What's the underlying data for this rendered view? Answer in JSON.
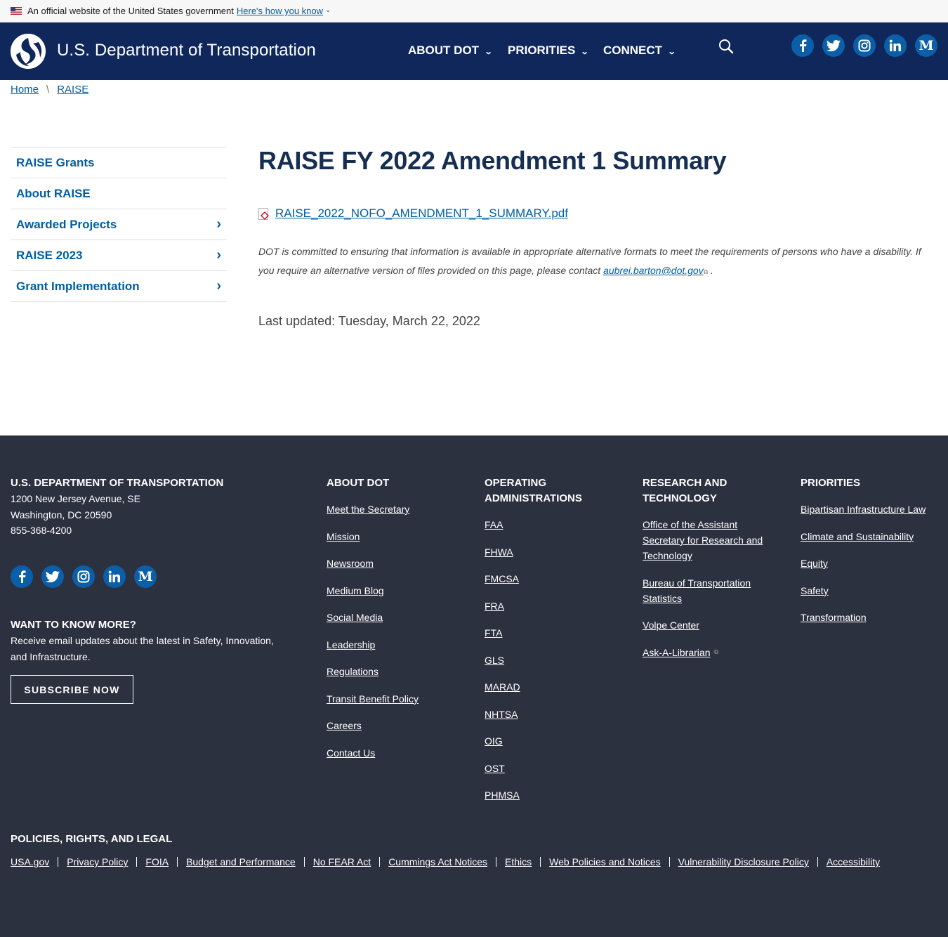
{
  "banner": {
    "text": "An official website of the United States government",
    "link": "Here's how you know"
  },
  "header": {
    "site_name": "U.S. Department of Transportation",
    "nav": [
      {
        "label": "ABOUT DOT"
      },
      {
        "label": "PRIORITIES"
      },
      {
        "label": "CONNECT"
      }
    ],
    "social": [
      {
        "icon": "facebook-icon",
        "glyph": "f"
      },
      {
        "icon": "twitter-icon",
        "glyph": "t"
      },
      {
        "icon": "instagram-icon",
        "glyph": "ig"
      },
      {
        "icon": "linkedin-icon",
        "glyph": "in"
      },
      {
        "icon": "medium-icon",
        "glyph": "M"
      }
    ]
  },
  "breadcrumb": {
    "items": [
      "Home",
      "RAISE"
    ],
    "separator": "\\"
  },
  "sidebar": {
    "items": [
      {
        "label": "RAISE Grants",
        "has_children": false
      },
      {
        "label": "About RAISE",
        "has_children": false
      },
      {
        "label": "Awarded Projects",
        "has_children": true
      },
      {
        "label": "RAISE 2023",
        "has_children": true
      },
      {
        "label": "Grant Implementation",
        "has_children": true
      }
    ]
  },
  "main": {
    "title": "RAISE FY 2022 Amendment 1 Summary",
    "file_name": "RAISE_2022_NOFO_AMENDMENT_1_SUMMARY.pdf",
    "notice_text": "DOT is committed to ensuring that information is available in appropriate alternative formats to meet the requirements of persons who have a disability. If you require an alternative version of files provided on this page, please contact",
    "notice_email": "aubrei.barton@dot.gov",
    "notice_end": ".",
    "last_updated": "Last updated: Tuesday, March 22, 2022"
  },
  "footer": {
    "org_head": "U.S. DEPARTMENT OF TRANSPORTATION",
    "address_line1": "1200 New Jersey Avenue, SE",
    "address_line2": "Washington, DC 20590",
    "phone": "855-368-4200",
    "want_head": "WANT TO KNOW MORE?",
    "want_text": "Receive email updates about the latest in Safety, Innovation, and Infrastructure.",
    "subscribe": "SUBSCRIBE NOW",
    "about_head": "ABOUT DOT",
    "about_links": [
      "Meet the Secretary",
      "Mission",
      "Newsroom",
      "Medium Blog",
      "Social Media",
      "Leadership",
      "Regulations",
      "Transit Benefit Policy",
      "Careers",
      "Contact Us"
    ],
    "ops_head": "OPERATING ADMINISTRATIONS",
    "ops_links": [
      "FAA",
      "FHWA",
      "FMCSA",
      "FRA",
      "FTA",
      "GLS",
      "MARAD",
      "NHTSA",
      "OIG",
      "OST",
      "PHMSA"
    ],
    "research_head": "RESEARCH AND TECHNOLOGY",
    "research_links": [
      "Office of the Assistant Secretary for Research and Technology",
      "Bureau of Transportation Statistics",
      "Volpe Center",
      "Ask-A-Librarian"
    ],
    "priorities_head": "PRIORITIES",
    "priorities_links": [
      "Bipartisan Infrastructure Law",
      "Climate and Sustainability",
      "Equity",
      "Safety",
      "Transformation"
    ],
    "policies_head": "POLICIES, RIGHTS, AND LEGAL",
    "policies_links": [
      "USA.gov",
      "Privacy Policy",
      "FOIA",
      "Budget and Performance",
      "No FEAR Act",
      "Cummings Act Notices",
      "Ethics",
      "Web Policies and Notices",
      "Vulnerability Disclosure Policy",
      "Accessibility"
    ]
  },
  "colors": {
    "header_bg": "#10275c",
    "link": "#005ea2",
    "title": "#162e51",
    "footer_bg": "#2c3140",
    "social_bg": "#0b5fa8"
  }
}
